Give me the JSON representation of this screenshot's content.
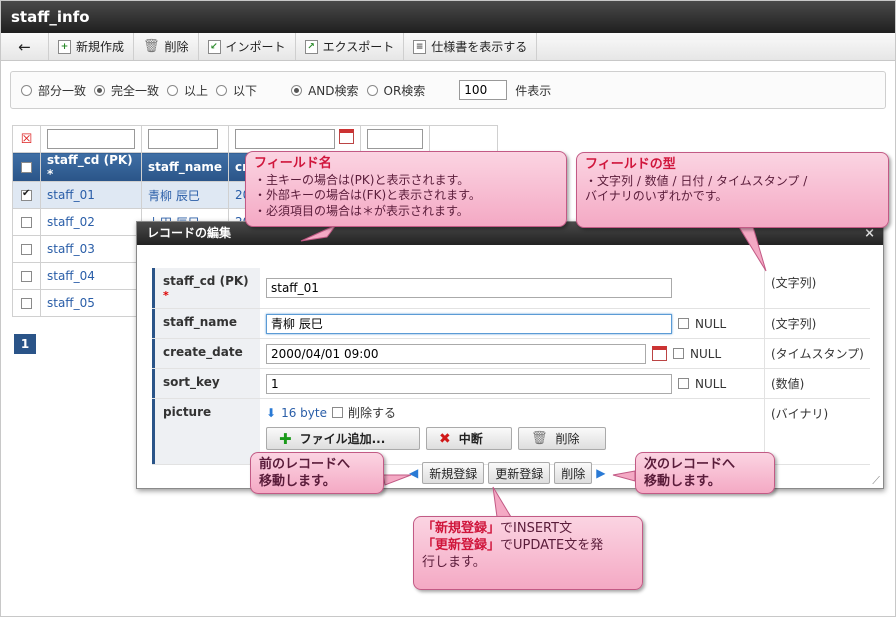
{
  "window": {
    "title": "staff_info"
  },
  "toolbar": {
    "back_label": "←",
    "new_label": "新規作成",
    "delete_label": "削除",
    "import_label": "インポート",
    "export_label": "エクスポート",
    "spec_label": "仕様書を表示する"
  },
  "filter": {
    "partial": "部分一致",
    "exact": "完全一致",
    "gte": "以上",
    "lte": "以下",
    "and": "AND検索",
    "or": "OR検索",
    "count_value": "100",
    "count_suffix": "件表示"
  },
  "grid": {
    "headers": [
      "staff_cd (PK) *",
      "staff_name",
      "cre"
    ],
    "rows": [
      {
        "cd": "staff_01",
        "name": "青柳 辰巳",
        "date": "200",
        "checked": true
      },
      {
        "cd": "staff_02",
        "name": "上田 辰巳",
        "date": "20",
        "checked": false
      },
      {
        "cd": "staff_03",
        "name": "",
        "date": "",
        "checked": false
      },
      {
        "cd": "staff_04",
        "name": "",
        "date": "",
        "checked": false
      },
      {
        "cd": "staff_05",
        "name": "",
        "date": "",
        "checked": false
      }
    ],
    "page": "1"
  },
  "dialog": {
    "title": "レコードの編集",
    "close": "×",
    "fields": [
      {
        "label": "staff_cd (PK)",
        "required": "*",
        "value": "staff_01",
        "type": "(文字列)"
      },
      {
        "label": "staff_name",
        "value": "青柳 辰巳",
        "null": "NULL",
        "type": "(文字列)"
      },
      {
        "label": "create_date",
        "value": "2000/04/01 09:00",
        "null": "NULL",
        "type": "(タイムスタンプ)"
      },
      {
        "label": "sort_key",
        "value": "1",
        "null": "NULL",
        "type": "(数値)"
      },
      {
        "label": "picture",
        "size": "16 byte",
        "delete_check": "削除する",
        "type": "(バイナリ)"
      }
    ],
    "add_file": "ファイル追加...",
    "cancel": "中断",
    "delete": "削除",
    "btn_new": "新規登録",
    "btn_update": "更新登録",
    "btn_delete": "削除"
  },
  "callouts": {
    "field_name": {
      "head": "フィールド名",
      "l1": "・主キーの場合は(PK)と表示されます。",
      "l2": "・外部キーの場合は(FK)と表示されます。",
      "l3": "・必須項目の場合は＊が表示されます。"
    },
    "field_type": {
      "head": "フィールドの型",
      "l1": "・文字列 / 数値 / 日付 / タイムスタンプ /",
      "l2": "バイナリのいずれかです。"
    },
    "prev": {
      "l1": "前のレコードへ",
      "l2": "移動します。"
    },
    "next": {
      "l1": "次のレコードへ",
      "l2": "移動します。"
    },
    "register": {
      "a1": "「新規登録」",
      "a2": "でINSERT文",
      "b1": "「更新登録」",
      "b2": "でUPDATE文を発",
      "c": "行します。"
    }
  },
  "colors": {
    "accent": "#2a5488",
    "callout": "#f4a9c4",
    "required": "#dd0000"
  }
}
